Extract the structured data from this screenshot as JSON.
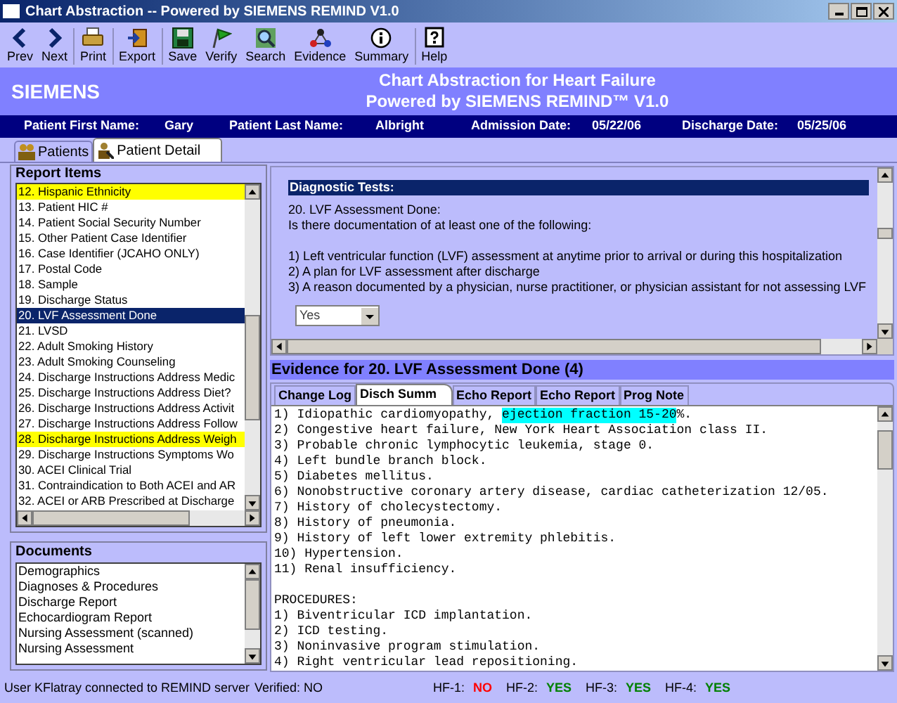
{
  "window": {
    "title": "Chart Abstraction -- Powered by SIEMENS REMIND V1.0"
  },
  "toolbar": [
    {
      "label": "Prev"
    },
    {
      "label": "Next"
    },
    {
      "label": "Print"
    },
    {
      "label": "Export"
    },
    {
      "label": "Save"
    },
    {
      "label": "Verify"
    },
    {
      "label": "Search"
    },
    {
      "label": "Evidence"
    },
    {
      "label": "Summary"
    },
    {
      "label": "Help"
    }
  ],
  "banner": {
    "brand": "SIEMENS",
    "title": "Chart Abstraction for Heart Failure",
    "subtitle": "Powered by SIEMENS REMIND™ V1.0"
  },
  "patient_bar": [
    {
      "label": "Patient First Name:",
      "value": "Gary"
    },
    {
      "label": "Patient Last Name:",
      "value": "Albright"
    },
    {
      "label": "Admission Date:",
      "value": "05/22/06"
    },
    {
      "label": "Discharge Date:",
      "value": "05/25/06"
    }
  ],
  "tabs": [
    {
      "label": "Patients",
      "selected": false
    },
    {
      "label": "Patient Detail",
      "selected": true
    }
  ],
  "report_items": {
    "title": "Report Items",
    "items": [
      {
        "label": "12. Hispanic Ethnicity",
        "highlighted": true,
        "selected": false
      },
      {
        "label": "13. Patient HIC #",
        "highlighted": false,
        "selected": false
      },
      {
        "label": "14. Patient Social Security Number",
        "highlighted": false,
        "selected": false
      },
      {
        "label": "15. Other Patient Case Identifier",
        "highlighted": false,
        "selected": false
      },
      {
        "label": "16. Case Identifier (JCAHO ONLY)",
        "highlighted": false,
        "selected": false
      },
      {
        "label": "17. Postal Code",
        "highlighted": false,
        "selected": false
      },
      {
        "label": "18. Sample",
        "highlighted": false,
        "selected": false
      },
      {
        "label": "19. Discharge Status",
        "highlighted": false,
        "selected": false
      },
      {
        "label": "20. LVF Assessment Done",
        "highlighted": false,
        "selected": true
      },
      {
        "label": "21. LVSD",
        "highlighted": false,
        "selected": false
      },
      {
        "label": "22. Adult Smoking History",
        "highlighted": false,
        "selected": false
      },
      {
        "label": "23. Adult Smoking Counseling",
        "highlighted": false,
        "selected": false
      },
      {
        "label": "24. Discharge Instructions Address Medic",
        "highlighted": false,
        "selected": false
      },
      {
        "label": "25. Discharge Instructions Address Diet?",
        "highlighted": false,
        "selected": false
      },
      {
        "label": "26. Discharge Instructions Address Activit",
        "highlighted": false,
        "selected": false
      },
      {
        "label": "27. Discharge Instructions Address Follow",
        "highlighted": false,
        "selected": false
      },
      {
        "label": "28. Discharge Instructions Address Weigh",
        "highlighted": true,
        "selected": false
      },
      {
        "label": "29. Discharge Instructions Symptoms Wo",
        "highlighted": false,
        "selected": false
      },
      {
        "label": "30. ACEI Clinical Trial",
        "highlighted": false,
        "selected": false
      },
      {
        "label": "31. Contraindication to Both ACEI and AR",
        "highlighted": false,
        "selected": false
      },
      {
        "label": "32. ACEI or ARB Prescribed at Discharge",
        "highlighted": false,
        "selected": false
      }
    ]
  },
  "documents": {
    "title": "Documents",
    "items": [
      "Demographics",
      "Diagnoses & Procedures",
      "Discharge Report",
      "Echocardiogram Report",
      "Nursing Assessment (scanned)",
      "Nursing Assessment"
    ]
  },
  "question": {
    "section": "Diagnostic Tests:",
    "title": "20. LVF Assessment Done:",
    "prompt": "Is there documentation of at least one of the following:",
    "options": [
      "1) Left ventricular function (LVF) assessment at anytime prior to arrival or during this hospitalization",
      "2) A plan for LVF assessment after discharge",
      "3) A reason documented by a physician, nurse practitioner, or physician assistant for not assessing LVF"
    ],
    "answer": "Yes"
  },
  "evidence": {
    "title": "Evidence for 20. LVF Assessment Done (4)",
    "tabs": [
      {
        "label": "Change Log",
        "selected": false
      },
      {
        "label": "Disch Summ",
        "selected": true
      },
      {
        "label": "Echo Report",
        "selected": false
      },
      {
        "label": "Echo Report",
        "selected": false
      },
      {
        "label": "Prog Note",
        "selected": false
      }
    ],
    "lines": [
      {
        "kind": "text",
        "segments": [
          {
            "text": "1) Idiopathic cardiomyopathy, ",
            "highlighted": false
          },
          {
            "text": "ejection fraction 15-20",
            "highlighted": true
          },
          {
            "text": "%.",
            "highlighted": false
          }
        ]
      },
      {
        "kind": "text",
        "segments": [
          {
            "text": "2) Congestive heart failure, New York Heart Association class II.",
            "highlighted": false
          }
        ]
      },
      {
        "kind": "text",
        "segments": [
          {
            "text": "3) Probable chronic lymphocytic leukemia, stage 0.",
            "highlighted": false
          }
        ]
      },
      {
        "kind": "text",
        "segments": [
          {
            "text": "4) Left bundle branch block.",
            "highlighted": false
          }
        ]
      },
      {
        "kind": "text",
        "segments": [
          {
            "text": "5) Diabetes mellitus.",
            "highlighted": false
          }
        ]
      },
      {
        "kind": "text",
        "segments": [
          {
            "text": "6) Nonobstructive coronary artery disease, cardiac catheterization 12/05.",
            "highlighted": false
          }
        ]
      },
      {
        "kind": "text",
        "segments": [
          {
            "text": "7) History of cholecystectomy.",
            "highlighted": false
          }
        ]
      },
      {
        "kind": "text",
        "segments": [
          {
            "text": "8) History of pneumonia.",
            "highlighted": false
          }
        ]
      },
      {
        "kind": "text",
        "segments": [
          {
            "text": "9) History of left lower extremity phlebitis.",
            "highlighted": false
          }
        ]
      },
      {
        "kind": "text",
        "segments": [
          {
            "text": "10) Hypertension.",
            "highlighted": false
          }
        ]
      },
      {
        "kind": "text",
        "segments": [
          {
            "text": "11) Renal insufficiency.",
            "highlighted": false
          }
        ]
      },
      {
        "kind": "blank"
      },
      {
        "kind": "text",
        "segments": [
          {
            "text": "PROCEDURES:",
            "highlighted": false
          }
        ]
      },
      {
        "kind": "text",
        "segments": [
          {
            "text": "1) Biventricular ICD implantation.",
            "highlighted": false
          }
        ]
      },
      {
        "kind": "text",
        "segments": [
          {
            "text": "2) ICD testing.",
            "highlighted": false
          }
        ]
      },
      {
        "kind": "text",
        "segments": [
          {
            "text": "3) Noninvasive program stimulation.",
            "highlighted": false
          }
        ]
      },
      {
        "kind": "text",
        "segments": [
          {
            "text": "4) Right ventricular lead repositioning.",
            "highlighted": false
          }
        ]
      }
    ]
  },
  "status_bar": {
    "connection": "User KFlatray connected to REMIND server",
    "verified": "Verified: NO",
    "measures": [
      {
        "label": "HF-1:",
        "value": "NO",
        "color": "#ff0000"
      },
      {
        "label": "HF-2:",
        "value": "YES",
        "color": "#008000"
      },
      {
        "label": "HF-3:",
        "value": "YES",
        "color": "#008000"
      },
      {
        "label": "HF-4:",
        "value": "YES",
        "color": "#008000"
      }
    ]
  }
}
